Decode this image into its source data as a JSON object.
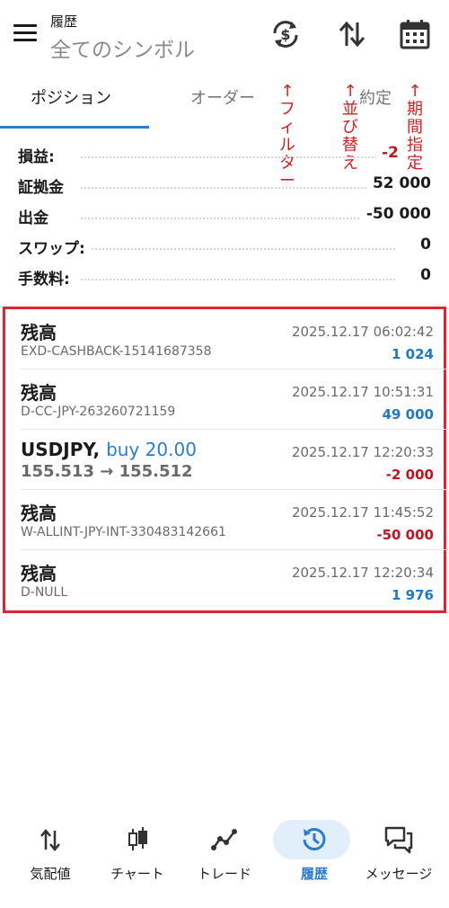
{
  "header": {
    "title": "履歴",
    "symbol_filter": "全てのシンボル"
  },
  "tabs": [
    {
      "label": "ポジション",
      "active": true
    },
    {
      "label": "オーダー",
      "active": false
    },
    {
      "label": "約定",
      "active": false
    }
  ],
  "annotations": {
    "filter": [
      "↑",
      "フ",
      "ィ",
      "ル",
      "タ",
      "ー"
    ],
    "sort": [
      "↑",
      "並",
      "び",
      "替",
      "え"
    ],
    "period": [
      "↑",
      "期",
      "間",
      "指",
      "定"
    ]
  },
  "summary": [
    {
      "label": "損益:",
      "value": "-2",
      "color": "#c0151f"
    },
    {
      "label": "証拠金",
      "value": "52 000",
      "color": "#1a1a1a"
    },
    {
      "label": "出金",
      "value": "-50 000",
      "color": "#1a1a1a"
    },
    {
      "label": "スワップ:",
      "value": "0",
      "color": "#1a1a1a"
    },
    {
      "label": "手数料:",
      "value": "0",
      "color": "#1a1a1a"
    }
  ],
  "deals": [
    {
      "name": "残高",
      "sub": "EXD-CASHBACK-15141687358",
      "time": "2025.12.17 06:02:42",
      "amount": "1 024",
      "sign": "pos"
    },
    {
      "name": "残高",
      "sub": "D-CC-JPY-263260721159",
      "time": "2025.12.17 10:51:31",
      "amount": "49 000",
      "sign": "pos"
    },
    {
      "name": "USDJPY,",
      "action": "buy 20.00",
      "sub": "155.513 → 155.512",
      "time": "2025.12.17 12:20:33",
      "amount": "-2 000",
      "sign": "neg"
    },
    {
      "name": "残高",
      "sub": "W-ALLINT-JPY-INT-330483142661",
      "time": "2025.12.17 11:45:52",
      "amount": "-50 000",
      "sign": "neg"
    },
    {
      "name": "残高",
      "sub": "D-NULL",
      "time": "2025.12.17 12:20:34",
      "amount": "1 976",
      "sign": "pos"
    }
  ],
  "bottom_nav": [
    {
      "label": "気配値",
      "icon": "up-down-arrows-icon"
    },
    {
      "label": "チャート",
      "icon": "candlestick-icon"
    },
    {
      "label": "トレード",
      "icon": "trend-line-icon"
    },
    {
      "label": "履歴",
      "icon": "history-icon",
      "active": true
    },
    {
      "label": "メッセージ",
      "icon": "chat-bubbles-icon"
    }
  ],
  "colors": {
    "accent": "#2b7cd1",
    "negative": "#c0151f",
    "highlight_box": "#e0242f",
    "annotation": "#d32020"
  }
}
